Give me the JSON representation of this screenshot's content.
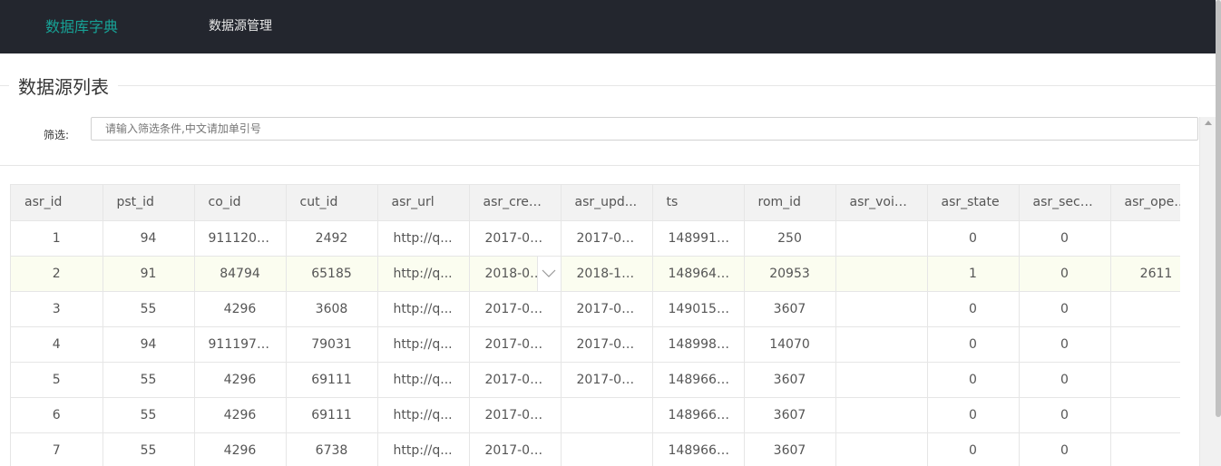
{
  "nav": {
    "active": "数据库字典",
    "second": "数据源管理"
  },
  "section": {
    "title": "数据源列表"
  },
  "filter": {
    "label": "筛选:",
    "placeholder": "请输入筛选条件,中文请加单引号",
    "value": ""
  },
  "table": {
    "columns": [
      "asr_id",
      "pst_id",
      "co_id",
      "cut_id",
      "asr_url",
      "asr_crea...",
      "asr_upd...",
      "ts",
      "rom_id",
      "asr_voic...",
      "asr_state",
      "asr_seco...",
      "asr_oper..."
    ],
    "rows": [
      [
        "1",
        "94",
        "91112033",
        "2492",
        "http://q...",
        "2017-03...",
        "2017-03...",
        "1489911...",
        "250",
        "",
        "0",
        "0",
        ""
      ],
      [
        "2",
        "91",
        "84794",
        "65185",
        "http://q...",
        "2018-08...",
        "2018-10...",
        "1489649...",
        "20953",
        "",
        "1",
        "0",
        "2611"
      ],
      [
        "3",
        "55",
        "4296",
        "3608",
        "http://q...",
        "2017-03...",
        "2017-03...",
        "1490151...",
        "3607",
        "",
        "0",
        "0",
        ""
      ],
      [
        "4",
        "94",
        "91119795",
        "79031",
        "http://q...",
        "2017-03...",
        "2017-03...",
        "1489981...",
        "14070",
        "",
        "0",
        "0",
        ""
      ],
      [
        "5",
        "55",
        "4296",
        "69111",
        "http://q...",
        "2017-03...",
        "2017-03...",
        "1489667...",
        "3607",
        "",
        "0",
        "0",
        ""
      ],
      [
        "6",
        "55",
        "4296",
        "69111",
        "http://q...",
        "2017-03...",
        "",
        "1489661...",
        "3607",
        "",
        "0",
        "0",
        ""
      ],
      [
        "7",
        "55",
        "4296",
        "6738",
        "http://q...",
        "2017-03...",
        "",
        "1489662...",
        "3607",
        "",
        "0",
        "0",
        ""
      ]
    ],
    "hover_row": 1,
    "expand_cell": {
      "row": 1,
      "col": 5,
      "icon": "chevron-down-icon"
    }
  },
  "colors": {
    "nav_bg": "#23262e",
    "nav_active": "#17a296",
    "header_bg": "#f2f2f2",
    "hover_row_bg": "#fbfdf0",
    "border": "#e6e6e6"
  }
}
